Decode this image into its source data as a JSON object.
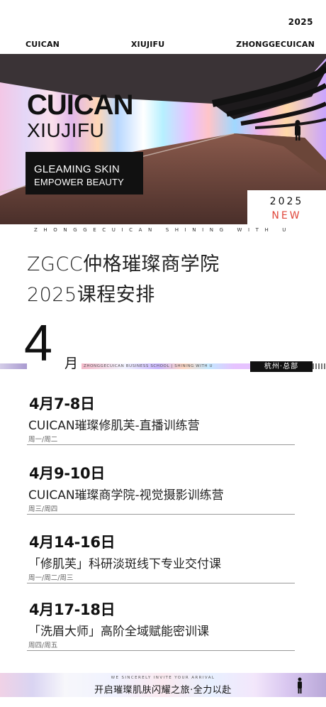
{
  "header": {
    "year": "2025",
    "nav": [
      "CUICAN",
      "XIUJIFU",
      "ZHONGGECUICAN"
    ]
  },
  "hero": {
    "title_line1": "CUICAN",
    "title_line2": "XIUJIFU",
    "box_line1": "GLEAMING SKIN",
    "box_line2": "EMPOWER BEAUTY",
    "badge_year": "2025",
    "badge_new": "NEW"
  },
  "tagline": "ZHONGGECUICAN SHINING WITH U",
  "heading": {
    "line1": "ZGCC仲格璀璨商学院",
    "line2": "2025课程安排"
  },
  "month": {
    "number": "4",
    "unit": "月",
    "band_text": "ZHONGGECUICAN BUSINESS SCHOOL  |  SHINING WITH U",
    "location": "杭州·总部"
  },
  "courses": [
    {
      "date": "4月7-8日",
      "title": "CUICAN璀璨修肌芙-直播训练营",
      "days": "周一/周二"
    },
    {
      "date": "4月9-10日",
      "title": "CUICAN璀璨商学院-视觉摄影训练营",
      "days": "周三/周四"
    },
    {
      "date": "4月14-16日",
      "title": "「修肌芙」科研淡斑线下专业交付课",
      "days": "周一/周二/周三"
    },
    {
      "date": "4月17-18日",
      "title": "「洗眉大师」高阶全域赋能密训课",
      "days": "周四/周五"
    }
  ],
  "footer": {
    "small": "WE SINCERELY INVITE YOUR ARRIVAL",
    "main": "开启璀璨肌肤闪耀之旅·全力以赴"
  },
  "colors": {
    "accent_new": "#e0463a",
    "black": "#111111"
  }
}
